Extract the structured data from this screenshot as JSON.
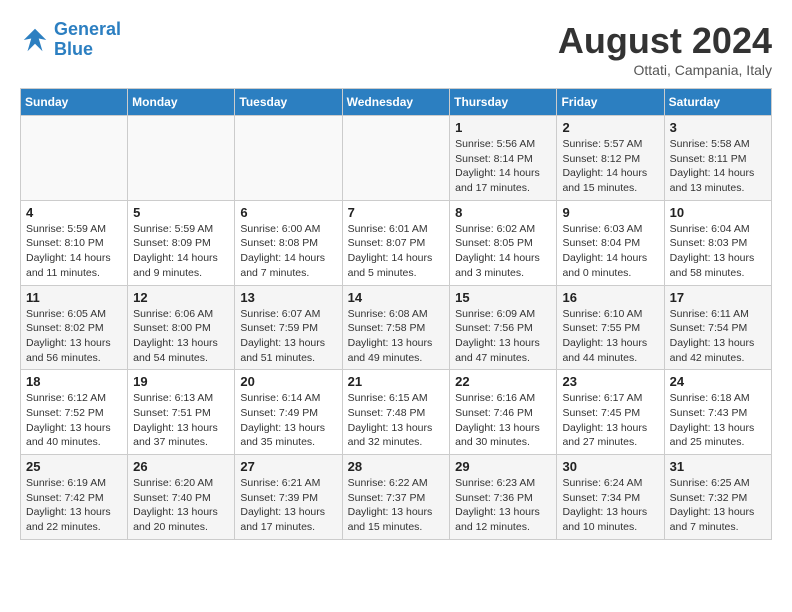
{
  "logo": {
    "line1": "General",
    "line2": "Blue"
  },
  "title": "August 2024",
  "subtitle": "Ottati, Campania, Italy",
  "days_of_week": [
    "Sunday",
    "Monday",
    "Tuesday",
    "Wednesday",
    "Thursday",
    "Friday",
    "Saturday"
  ],
  "weeks": [
    [
      {
        "day": "",
        "info": ""
      },
      {
        "day": "",
        "info": ""
      },
      {
        "day": "",
        "info": ""
      },
      {
        "day": "",
        "info": ""
      },
      {
        "day": "1",
        "info": "Sunrise: 5:56 AM\nSunset: 8:14 PM\nDaylight: 14 hours and 17 minutes."
      },
      {
        "day": "2",
        "info": "Sunrise: 5:57 AM\nSunset: 8:12 PM\nDaylight: 14 hours and 15 minutes."
      },
      {
        "day": "3",
        "info": "Sunrise: 5:58 AM\nSunset: 8:11 PM\nDaylight: 14 hours and 13 minutes."
      }
    ],
    [
      {
        "day": "4",
        "info": "Sunrise: 5:59 AM\nSunset: 8:10 PM\nDaylight: 14 hours and 11 minutes."
      },
      {
        "day": "5",
        "info": "Sunrise: 5:59 AM\nSunset: 8:09 PM\nDaylight: 14 hours and 9 minutes."
      },
      {
        "day": "6",
        "info": "Sunrise: 6:00 AM\nSunset: 8:08 PM\nDaylight: 14 hours and 7 minutes."
      },
      {
        "day": "7",
        "info": "Sunrise: 6:01 AM\nSunset: 8:07 PM\nDaylight: 14 hours and 5 minutes."
      },
      {
        "day": "8",
        "info": "Sunrise: 6:02 AM\nSunset: 8:05 PM\nDaylight: 14 hours and 3 minutes."
      },
      {
        "day": "9",
        "info": "Sunrise: 6:03 AM\nSunset: 8:04 PM\nDaylight: 14 hours and 0 minutes."
      },
      {
        "day": "10",
        "info": "Sunrise: 6:04 AM\nSunset: 8:03 PM\nDaylight: 13 hours and 58 minutes."
      }
    ],
    [
      {
        "day": "11",
        "info": "Sunrise: 6:05 AM\nSunset: 8:02 PM\nDaylight: 13 hours and 56 minutes."
      },
      {
        "day": "12",
        "info": "Sunrise: 6:06 AM\nSunset: 8:00 PM\nDaylight: 13 hours and 54 minutes."
      },
      {
        "day": "13",
        "info": "Sunrise: 6:07 AM\nSunset: 7:59 PM\nDaylight: 13 hours and 51 minutes."
      },
      {
        "day": "14",
        "info": "Sunrise: 6:08 AM\nSunset: 7:58 PM\nDaylight: 13 hours and 49 minutes."
      },
      {
        "day": "15",
        "info": "Sunrise: 6:09 AM\nSunset: 7:56 PM\nDaylight: 13 hours and 47 minutes."
      },
      {
        "day": "16",
        "info": "Sunrise: 6:10 AM\nSunset: 7:55 PM\nDaylight: 13 hours and 44 minutes."
      },
      {
        "day": "17",
        "info": "Sunrise: 6:11 AM\nSunset: 7:54 PM\nDaylight: 13 hours and 42 minutes."
      }
    ],
    [
      {
        "day": "18",
        "info": "Sunrise: 6:12 AM\nSunset: 7:52 PM\nDaylight: 13 hours and 40 minutes."
      },
      {
        "day": "19",
        "info": "Sunrise: 6:13 AM\nSunset: 7:51 PM\nDaylight: 13 hours and 37 minutes."
      },
      {
        "day": "20",
        "info": "Sunrise: 6:14 AM\nSunset: 7:49 PM\nDaylight: 13 hours and 35 minutes."
      },
      {
        "day": "21",
        "info": "Sunrise: 6:15 AM\nSunset: 7:48 PM\nDaylight: 13 hours and 32 minutes."
      },
      {
        "day": "22",
        "info": "Sunrise: 6:16 AM\nSunset: 7:46 PM\nDaylight: 13 hours and 30 minutes."
      },
      {
        "day": "23",
        "info": "Sunrise: 6:17 AM\nSunset: 7:45 PM\nDaylight: 13 hours and 27 minutes."
      },
      {
        "day": "24",
        "info": "Sunrise: 6:18 AM\nSunset: 7:43 PM\nDaylight: 13 hours and 25 minutes."
      }
    ],
    [
      {
        "day": "25",
        "info": "Sunrise: 6:19 AM\nSunset: 7:42 PM\nDaylight: 13 hours and 22 minutes."
      },
      {
        "day": "26",
        "info": "Sunrise: 6:20 AM\nSunset: 7:40 PM\nDaylight: 13 hours and 20 minutes."
      },
      {
        "day": "27",
        "info": "Sunrise: 6:21 AM\nSunset: 7:39 PM\nDaylight: 13 hours and 17 minutes."
      },
      {
        "day": "28",
        "info": "Sunrise: 6:22 AM\nSunset: 7:37 PM\nDaylight: 13 hours and 15 minutes."
      },
      {
        "day": "29",
        "info": "Sunrise: 6:23 AM\nSunset: 7:36 PM\nDaylight: 13 hours and 12 minutes."
      },
      {
        "day": "30",
        "info": "Sunrise: 6:24 AM\nSunset: 7:34 PM\nDaylight: 13 hours and 10 minutes."
      },
      {
        "day": "31",
        "info": "Sunrise: 6:25 AM\nSunset: 7:32 PM\nDaylight: 13 hours and 7 minutes."
      }
    ]
  ]
}
